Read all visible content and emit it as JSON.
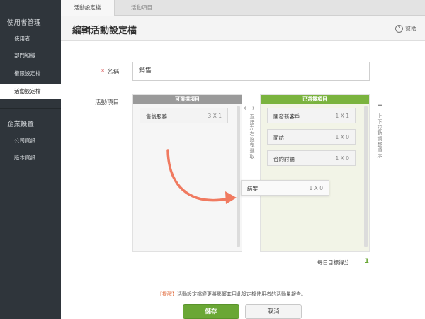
{
  "sidebar": {
    "sections": [
      {
        "title": "使用者管理",
        "items": [
          "使用者",
          "部門組織",
          "權限設定檔",
          "活動設定檔"
        ]
      },
      {
        "title": "企業設置",
        "items": [
          "公司資訊",
          "版本資訊"
        ]
      }
    ]
  },
  "tabs": [
    "活動設定檔",
    "活動項目"
  ],
  "header": {
    "title": "編輯活動設定檔",
    "help_label": "幫助",
    "help_icon": "question-circle-icon"
  },
  "form": {
    "required_mark": "*",
    "name_label": "名稱",
    "name_value": "銷售",
    "activity_label": "活動項目"
  },
  "available": {
    "header": "可選擇項目",
    "items": [
      {
        "name": "售後服務",
        "score": "3 X 1"
      }
    ],
    "hint": "直接左右拖曳選取"
  },
  "selected": {
    "header": "已選擇項目",
    "items": [
      {
        "name": "開發新客戶",
        "score": "1 X 1"
      },
      {
        "name": "面訪",
        "score": "1 X 0"
      },
      {
        "name": "合約討論",
        "score": "1 X 0"
      }
    ],
    "hint": "上下拉動調整順序",
    "hint_mark": "I"
  },
  "dragging_item": {
    "name": "結案",
    "score": "1 X 0"
  },
  "daily_score": {
    "label": "每日目標得分:",
    "value": "1"
  },
  "notice": {
    "tag": "【提醒】",
    "text": "活動設定檔變更將影響套用此設定檔使用者的活動量報告。"
  },
  "buttons": {
    "save": "儲存",
    "cancel": "取消"
  },
  "colors": {
    "accent": "#7ab33e",
    "arrow": "#f07a60",
    "sidebar_bg": "#2f353b"
  }
}
